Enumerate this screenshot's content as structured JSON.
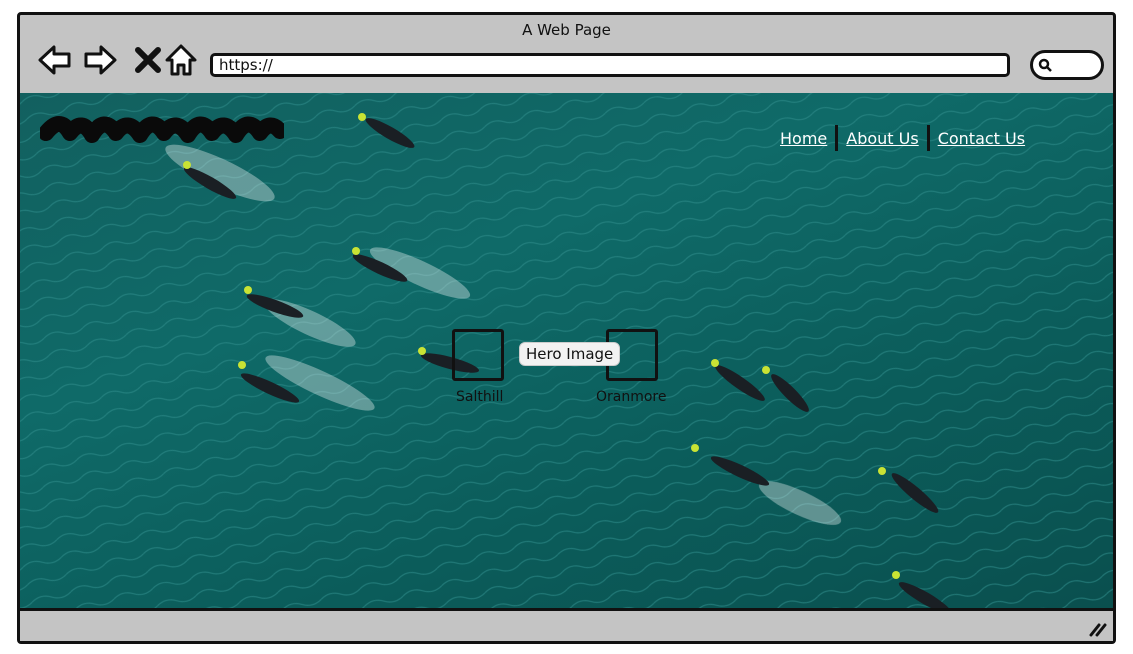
{
  "browser": {
    "title": "A Web Page",
    "url": "https://"
  },
  "nav": {
    "items": [
      "Home",
      "About Us",
      "Contact Us"
    ]
  },
  "hero": {
    "label": "Hero Image",
    "markers": [
      "Salthill",
      "Oranmore"
    ]
  },
  "colors": {
    "chrome": "#c4c4c4",
    "water": "#0f6a68"
  }
}
